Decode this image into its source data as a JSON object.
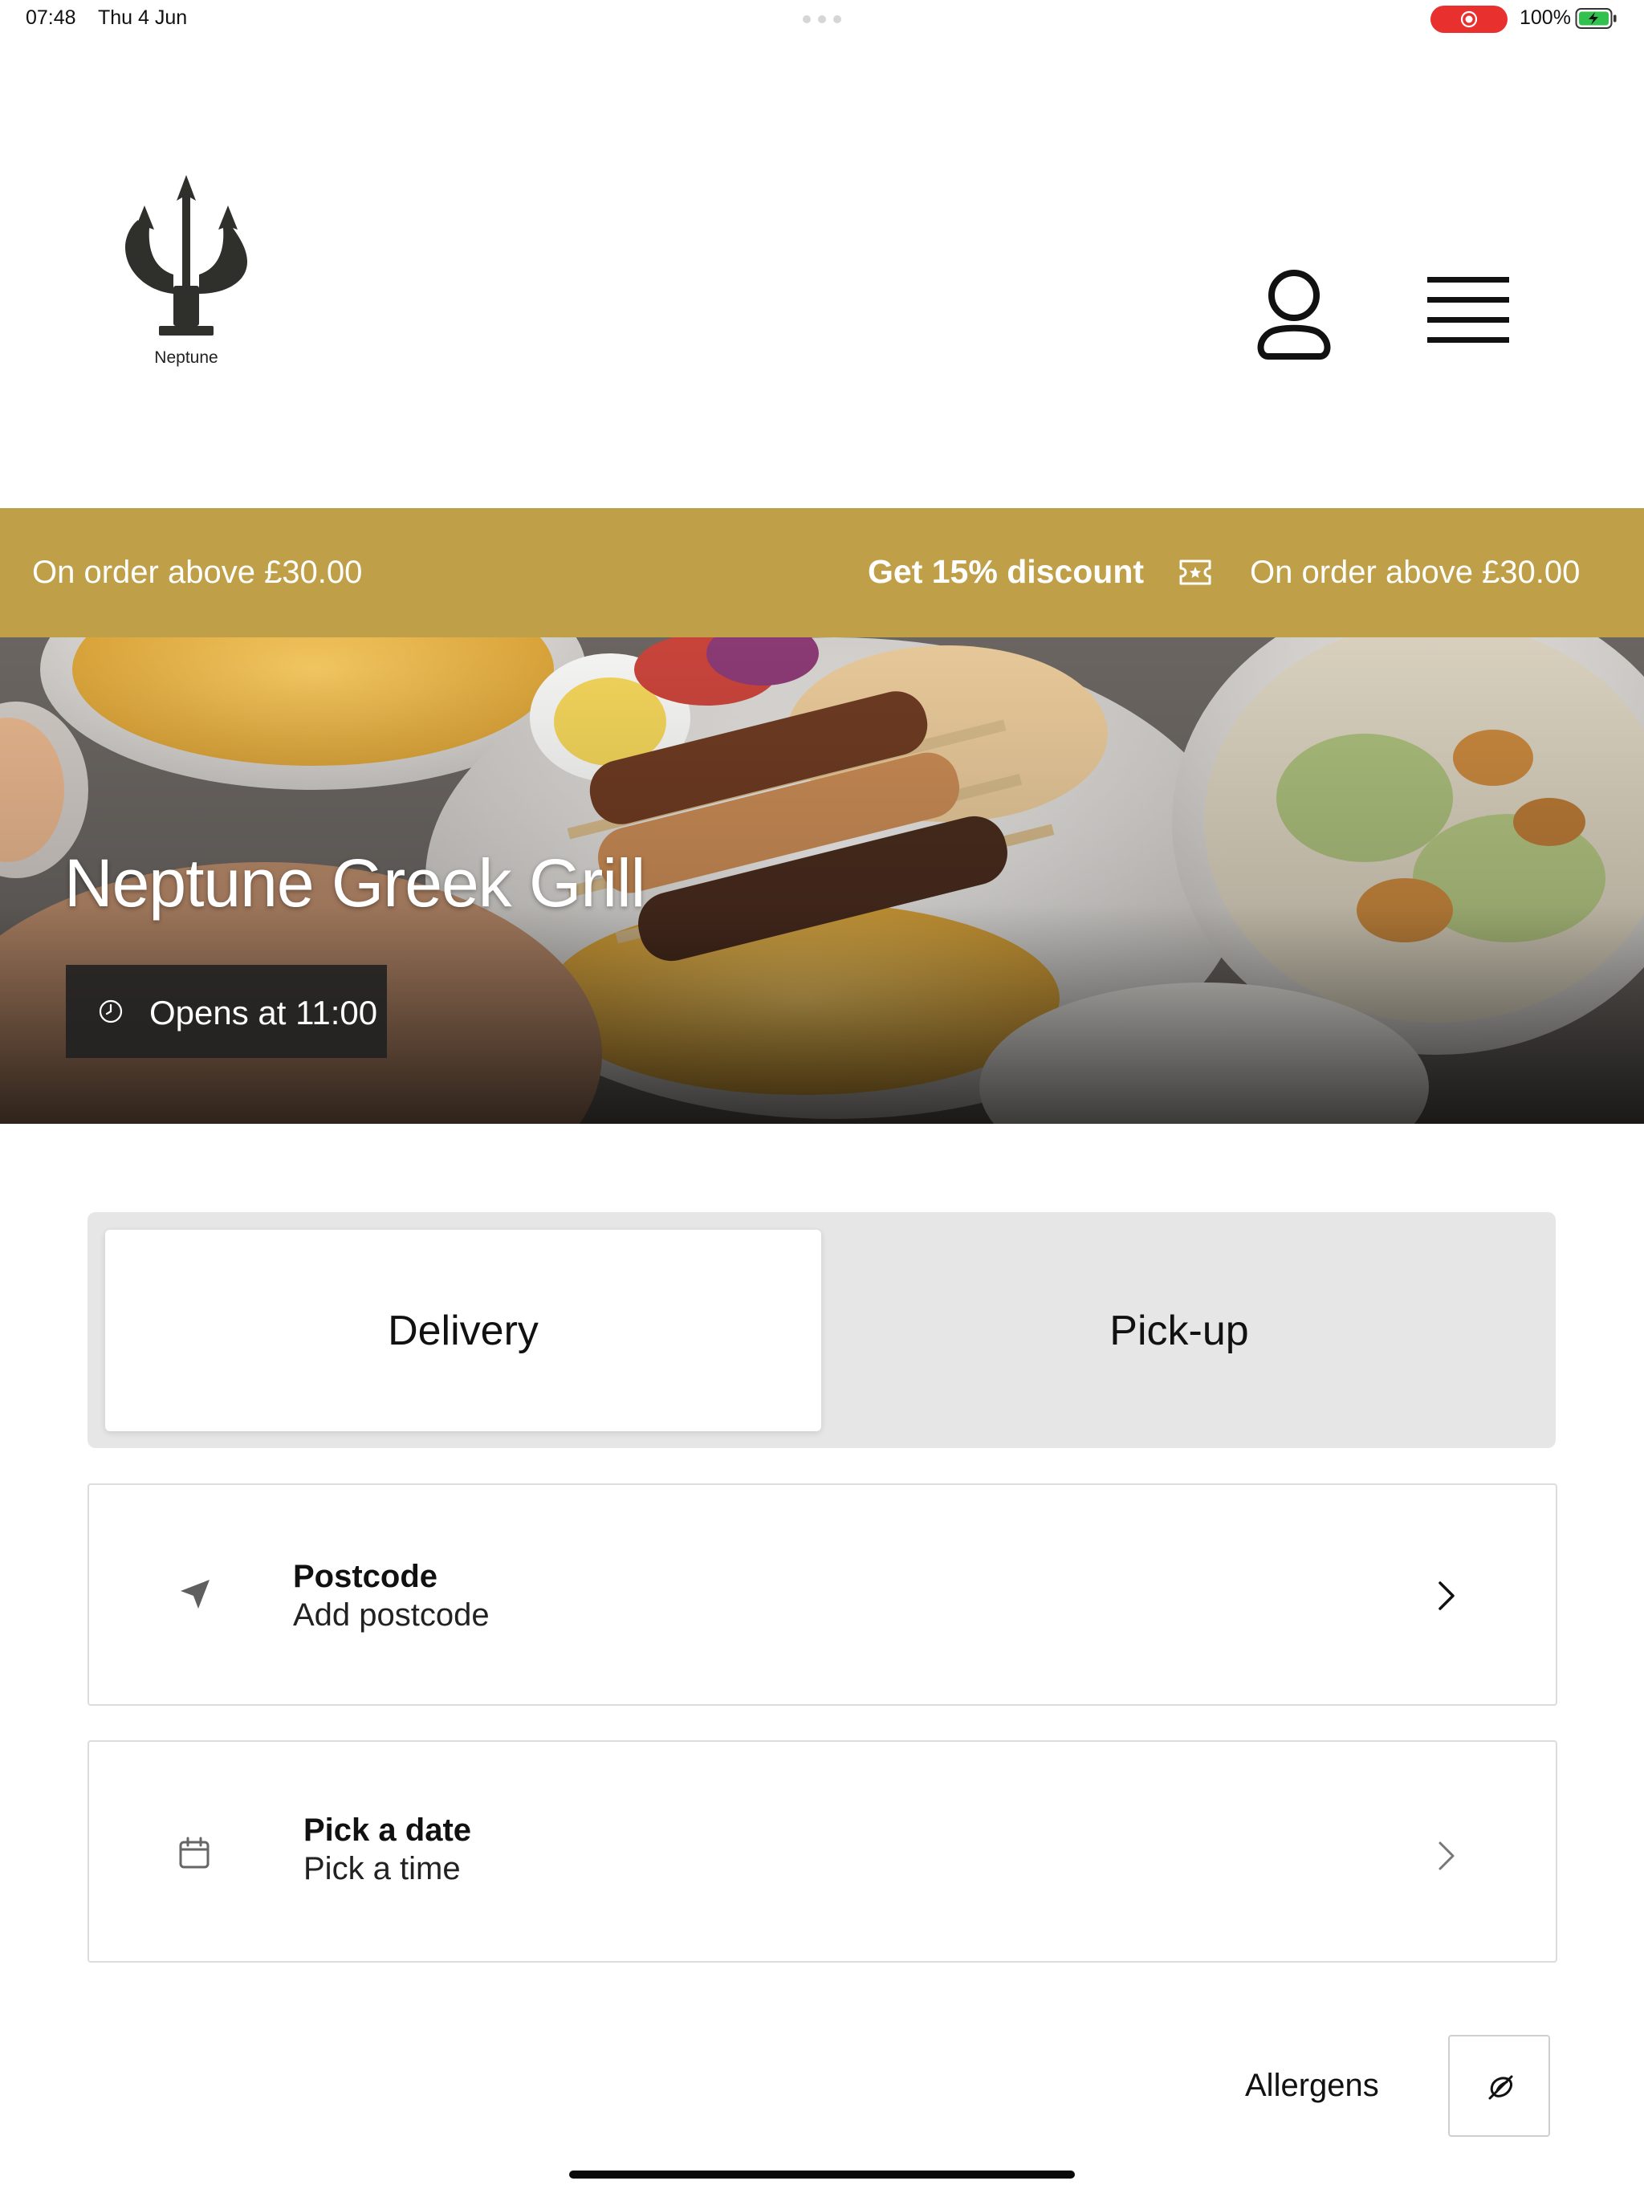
{
  "status_bar": {
    "time": "07:48",
    "date": "Thu 4 Jun",
    "battery_percent": "100%",
    "record_color": "#e8312f",
    "battery_color": "#32c04e"
  },
  "header": {
    "logo_text": "Neptune",
    "logo_icon": "trident-icon",
    "account_icon": "user-icon",
    "menu_icon": "hamburger-menu-icon"
  },
  "promo": {
    "background_color": "#bf9f48",
    "left_text": "On order above £30.00",
    "headline": "Get 15% discount",
    "icon": "ticket-icon",
    "right_text": "On order above £30.00"
  },
  "hero": {
    "title": "Neptune Greek Grill",
    "hours_text": "Opens at 11:00",
    "hours_icon": "clock-icon"
  },
  "order_type": {
    "tabs": [
      {
        "label": "Delivery",
        "selected": true
      },
      {
        "label": "Pick-up",
        "selected": false
      }
    ]
  },
  "postcode": {
    "icon": "location-arrow-icon",
    "title": "Postcode",
    "subtitle": "Add postcode"
  },
  "schedule": {
    "icon": "calendar-icon",
    "title": "Pick a date",
    "subtitle": "Pick a time"
  },
  "allergens": {
    "label": "Allergens",
    "icon": "allergen-icon"
  }
}
